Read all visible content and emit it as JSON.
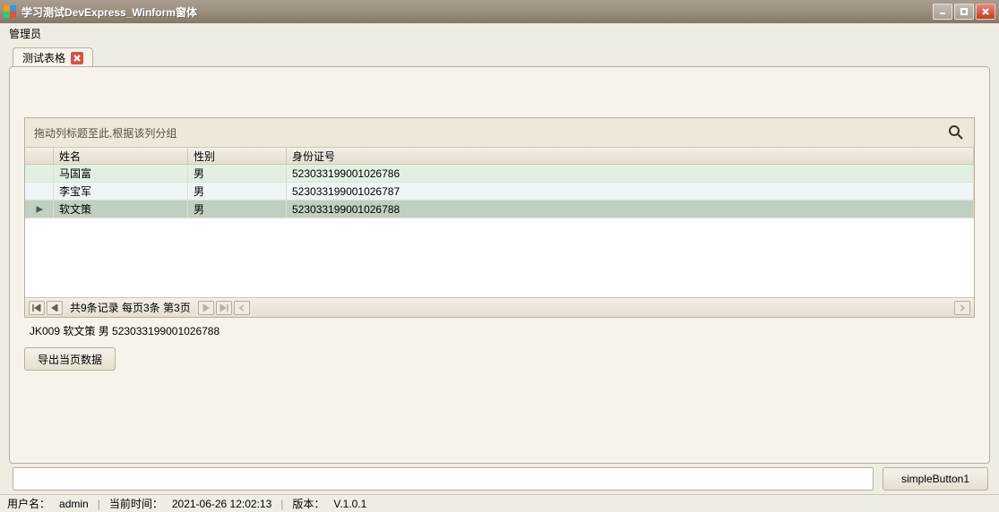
{
  "window": {
    "title": "学习测试DevExpress_Winform窗体"
  },
  "menu": {
    "admin": "管理员"
  },
  "tabs": [
    {
      "label": "测试表格"
    }
  ],
  "grid": {
    "group_hint": "拖动列标题至此,根据该列分组",
    "columns": {
      "name": "姓名",
      "sex": "性别",
      "idno": "身份证号"
    },
    "rows": [
      {
        "name": "马国富",
        "sex": "男",
        "idno": "523033199001026786"
      },
      {
        "name": "李宝军",
        "sex": "男",
        "idno": "523033199001026787"
      },
      {
        "name": "软文策",
        "sex": "男",
        "idno": "523033199001026788"
      }
    ],
    "pager_text": "共9条记录 每页3条 第3页",
    "detail_line": "JK009   软文策   男   523033199001026788",
    "export_label": "导出当页数据"
  },
  "bottom": {
    "simple_button": "simpleButton1",
    "input_value": ""
  },
  "status": {
    "user_label": "用户名：",
    "user_value": "admin",
    "time_label": "当前时间：",
    "time_value": "2021-06-26 12:02:13",
    "ver_label": "版本：",
    "ver_value": "V.1.0.1"
  }
}
